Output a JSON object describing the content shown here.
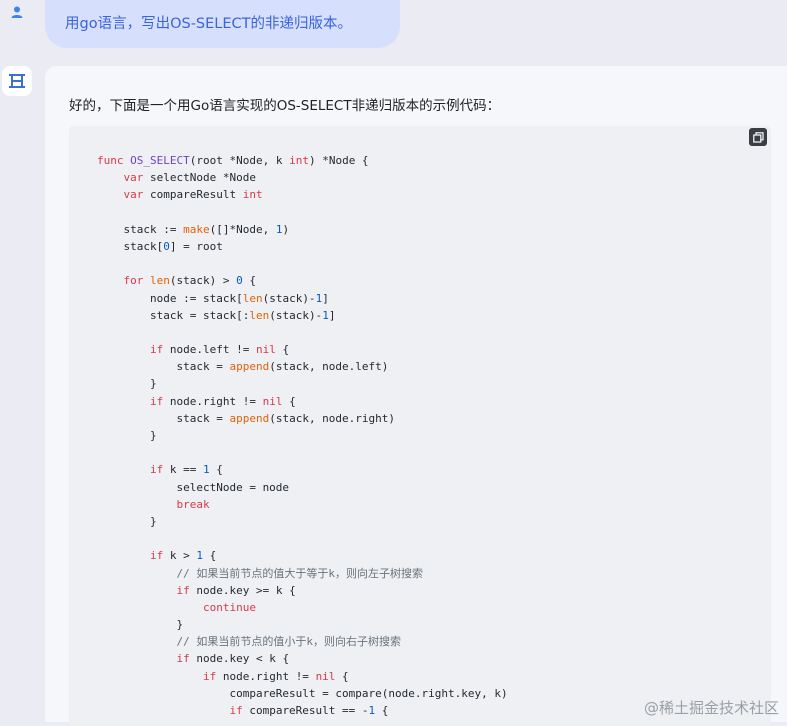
{
  "user_message": {
    "text": "用go语言，写出OS-SELECT的非递归版本。"
  },
  "answer": {
    "intro": "好的，下面是一个用Go语言实现的OS-SELECT非递归版本的示例代码：",
    "copy_icon": "copy-icon",
    "code_lines": [
      "func OS_SELECT(root *Node, k int) *Node {",
      "    var selectNode *Node",
      "    var compareResult int",
      "",
      "    stack := make([]*Node, 1)",
      "    stack[0] = root",
      "",
      "    for len(stack) > 0 {",
      "        node := stack[len(stack)-1]",
      "        stack = stack[:len(stack)-1]",
      "",
      "        if node.left != nil {",
      "            stack = append(stack, node.left)",
      "        }",
      "        if node.right != nil {",
      "            stack = append(stack, node.right)",
      "        }",
      "",
      "        if k == 1 {",
      "            selectNode = node",
      "            break",
      "        }",
      "",
      "        if k > 1 {",
      "            // 如果当前节点的值大于等于k，则向左子树搜索",
      "            if node.key >= k {",
      "                continue",
      "            }",
      "            // 如果当前节点的值小于k，则向右子树搜索",
      "            if node.key < k {",
      "                if node.right != nil {",
      "                    compareResult = compare(node.right.key, k)",
      "                    if compareResult == -1 {"
    ]
  },
  "watermark": {
    "text": "@稀土掘金技术社区"
  },
  "colors": {
    "keyword": "#d73a49",
    "function": "#6f42c1",
    "number": "#005cc5",
    "builtin": "#e36209",
    "comment": "#6a737d",
    "user_bubble": "#d6dffb",
    "user_text": "#3a63e0"
  }
}
